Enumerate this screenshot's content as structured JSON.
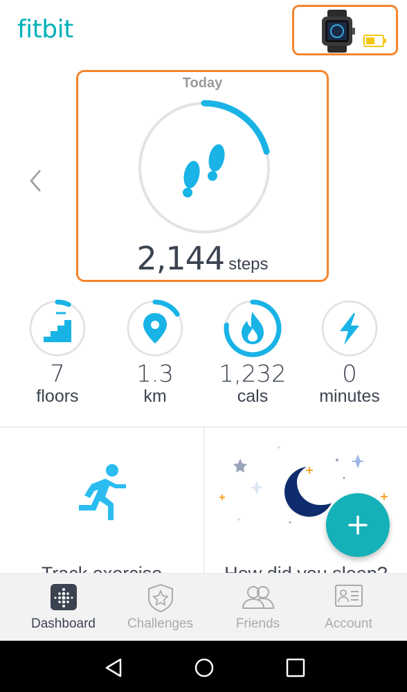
{
  "header": {
    "logo_text": "fitbit"
  },
  "device": {
    "icon": "watch-icon",
    "battery_icon": "battery-low-icon",
    "battery_color": "#f5c518"
  },
  "today": {
    "label": "Today",
    "steps_value": "2,144",
    "steps_unit": "steps",
    "progress_fraction": 0.21,
    "icon": "footprints-icon"
  },
  "stats": [
    {
      "value": "7",
      "unit": "floors",
      "icon": "stairs-icon",
      "progress_fraction": 0.07
    },
    {
      "value": "1.3",
      "unit": "km",
      "icon": "location-pin-icon",
      "progress_fraction": 0.16
    },
    {
      "value": "1,232",
      "unit": "cals",
      "icon": "flame-icon",
      "progress_fraction": 0.77
    },
    {
      "value": "0",
      "unit": "minutes",
      "icon": "lightning-icon",
      "progress_fraction": 0
    }
  ],
  "tiles": {
    "exercise_title": "Track exercise",
    "exercise_icon": "runner-icon",
    "sleep_title": "How did you sleep?",
    "sleep_icon": "moon-stars-icon"
  },
  "fab": {
    "icon": "plus-icon"
  },
  "nav": {
    "items": [
      {
        "label": "Dashboard",
        "icon": "dashboard-icon",
        "active": true
      },
      {
        "label": "Challenges",
        "icon": "challenges-icon",
        "active": false
      },
      {
        "label": "Friends",
        "icon": "friends-icon",
        "active": false
      },
      {
        "label": "Account",
        "icon": "account-icon",
        "active": false
      }
    ]
  },
  "colors": {
    "accent": "#00b0b9",
    "ring_progress": "#19b3e6",
    "highlight": "#f4842b",
    "text_dark": "#3b4350"
  }
}
